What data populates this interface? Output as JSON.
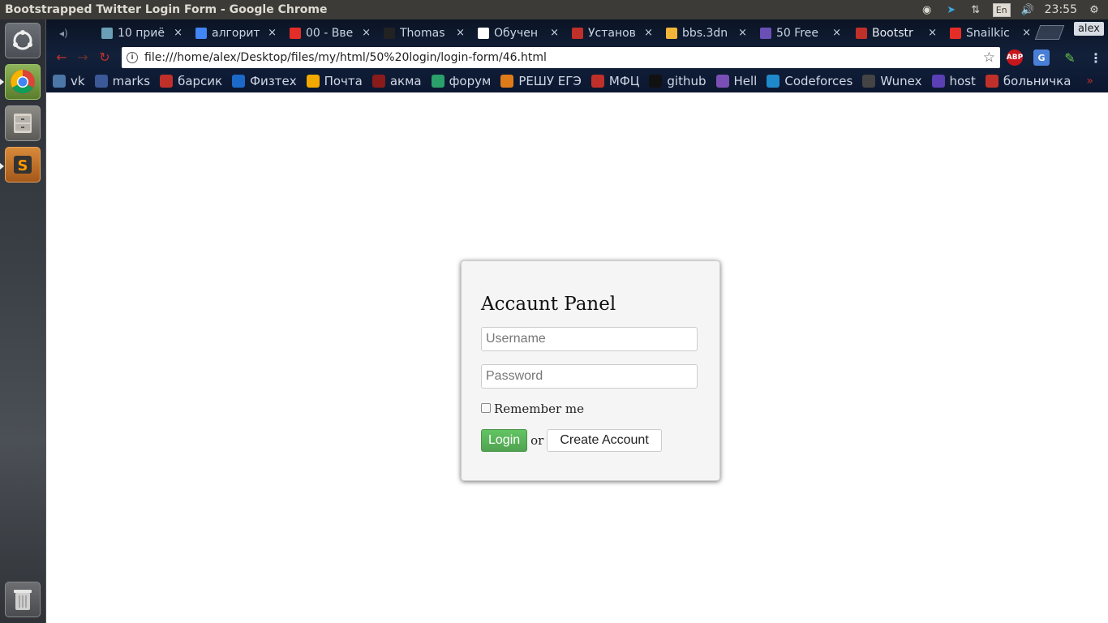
{
  "window": {
    "title": "Bootstrapped Twitter Login Form - Google Chrome"
  },
  "tray": {
    "lang": "En",
    "clock": "23:55"
  },
  "tabs": [
    {
      "title": "10 приё",
      "color": "#6a9fb5"
    },
    {
      "title": "алгорит",
      "color": "#4285f4"
    },
    {
      "title": "00 - Вве",
      "color": "#e52d27"
    },
    {
      "title": "Thomas",
      "color": "#222222"
    },
    {
      "title": "Обучен",
      "color": "#ffffff"
    },
    {
      "title": "Установ",
      "color": "#c0302a"
    },
    {
      "title": "bbs.3dn",
      "color": "#f2b53a"
    },
    {
      "title": "50 Free",
      "color": "#6a4fb5"
    },
    {
      "title": "Bootstr",
      "color": "#c0302a"
    },
    {
      "title": "Snailkic",
      "color": "#e52d27"
    }
  ],
  "profile": "alex",
  "omnibox": {
    "url": "file:///home/alex/Desktop/files/my/html/50%20login/login-form/46.html"
  },
  "extensions": {
    "abp": "ABP",
    "translate": "G"
  },
  "bookmarks": [
    {
      "label": "vk",
      "color": "#4a76a8"
    },
    {
      "label": "marks",
      "color": "#3b5998"
    },
    {
      "label": "барсик",
      "color": "#c0302a"
    },
    {
      "label": "Физтех",
      "color": "#1b6ac9"
    },
    {
      "label": "Почта",
      "color": "#f2a900"
    },
    {
      "label": "акма",
      "color": "#8a1b1b"
    },
    {
      "label": "форум",
      "color": "#2aa06b"
    },
    {
      "label": "РЕШУ ЕГЭ",
      "color": "#e07b1a"
    },
    {
      "label": "МФЦ",
      "color": "#c0302a"
    },
    {
      "label": "github",
      "color": "#111111"
    },
    {
      "label": "Hell",
      "color": "#7a4fb5"
    },
    {
      "label": "Codeforces",
      "color": "#1f8acb"
    },
    {
      "label": "Wunex",
      "color": "#444444"
    },
    {
      "label": "host",
      "color": "#5a3fb5"
    },
    {
      "label": "больничка",
      "color": "#c0302a"
    }
  ],
  "panel": {
    "title": "Accaunt Panel",
    "username_placeholder": "Username",
    "password_placeholder": "Password",
    "remember_label": "Remember me",
    "login_label": "Login",
    "or_text": "or",
    "create_label": "Create Account"
  }
}
